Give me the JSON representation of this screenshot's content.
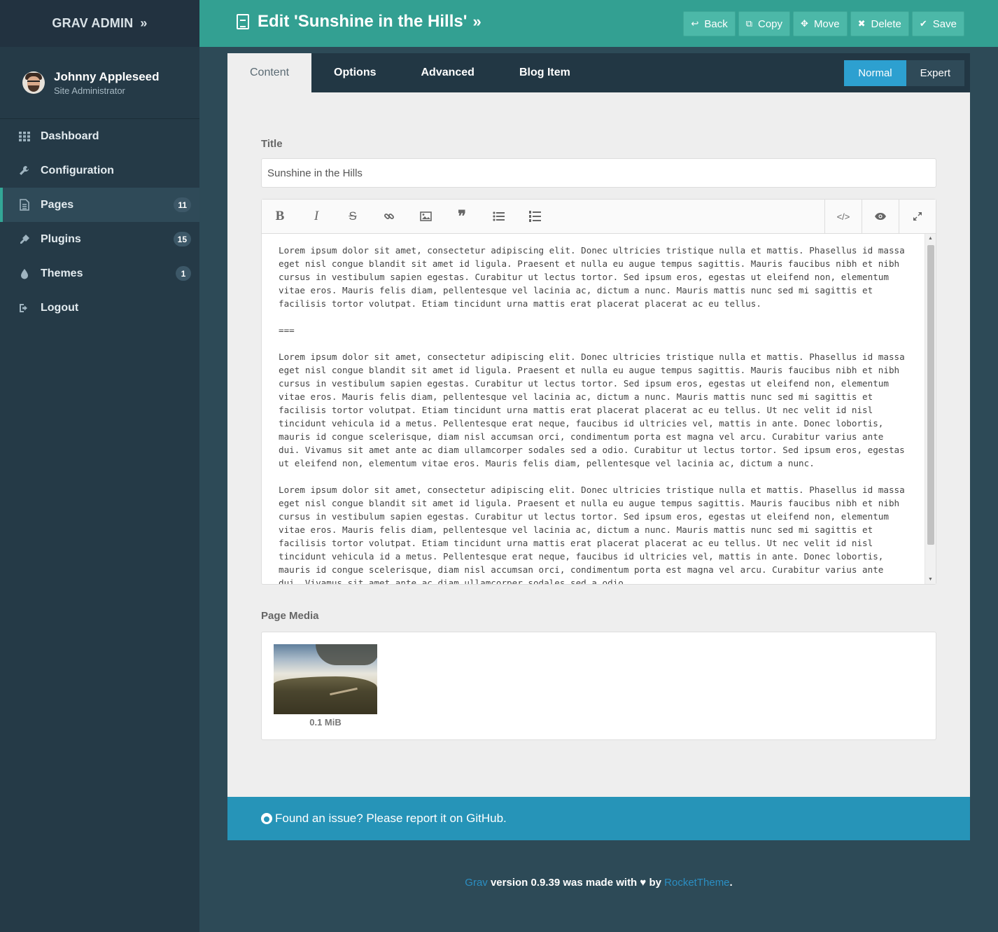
{
  "sidebar": {
    "brand": "GRAV ADMIN",
    "brand_chevron": "»",
    "user": {
      "name": "Johnny Appleseed",
      "role": "Site Administrator"
    },
    "items": [
      {
        "label": "Dashboard",
        "icon": "grid-icon",
        "badge": ""
      },
      {
        "label": "Configuration",
        "icon": "wrench-icon",
        "badge": ""
      },
      {
        "label": "Pages",
        "icon": "file-icon",
        "badge": "11"
      },
      {
        "label": "Plugins",
        "icon": "plug-icon",
        "badge": "15"
      },
      {
        "label": "Themes",
        "icon": "tint-icon",
        "badge": "1"
      },
      {
        "label": "Logout",
        "icon": "sign-out-icon",
        "badge": ""
      }
    ]
  },
  "header": {
    "title": "Edit 'Sunshine in the Hills'",
    "title_chevron": "»",
    "actions": [
      {
        "label": "Back",
        "icon": "reply-icon"
      },
      {
        "label": "Copy",
        "icon": "copy-icon"
      },
      {
        "label": "Move",
        "icon": "arrows-icon"
      },
      {
        "label": "Delete",
        "icon": "close-icon"
      },
      {
        "label": "Save",
        "icon": "check-icon"
      }
    ]
  },
  "tabs": [
    "Content",
    "Options",
    "Advanced",
    "Blog Item"
  ],
  "mode": {
    "normal": "Normal",
    "expert": "Expert"
  },
  "form": {
    "title_label": "Title",
    "title_value": "Sunshine in the Hills",
    "content": "Lorem ipsum dolor sit amet, consectetur adipiscing elit. Donec ultricies tristique nulla et mattis. Phasellus id massa eget nisl congue blandit sit amet id ligula. Praesent et nulla eu augue tempus sagittis. Mauris faucibus nibh et nibh cursus in vestibulum sapien egestas. Curabitur ut lectus tortor. Sed ipsum eros, egestas ut eleifend non, elementum vitae eros. Mauris felis diam, pellentesque vel lacinia ac, dictum a nunc. Mauris mattis nunc sed mi sagittis et facilisis tortor volutpat. Etiam tincidunt urna mattis erat placerat placerat ac eu tellus.\n\n===\n\nLorem ipsum dolor sit amet, consectetur adipiscing elit. Donec ultricies tristique nulla et mattis. Phasellus id massa eget nisl congue blandit sit amet id ligula. Praesent et nulla eu augue tempus sagittis. Mauris faucibus nibh et nibh cursus in vestibulum sapien egestas. Curabitur ut lectus tortor. Sed ipsum eros, egestas ut eleifend non, elementum vitae eros. Mauris felis diam, pellentesque vel lacinia ac, dictum a nunc. Mauris mattis nunc sed mi sagittis et facilisis tortor volutpat. Etiam tincidunt urna mattis erat placerat placerat ac eu tellus. Ut nec velit id nisl tincidunt vehicula id a metus. Pellentesque erat neque, faucibus id ultricies vel, mattis in ante. Donec lobortis, mauris id congue scelerisque, diam nisl accumsan orci, condimentum porta est magna vel arcu. Curabitur varius ante dui. Vivamus sit amet ante ac diam ullamcorper sodales sed a odio. Curabitur ut lectus tortor. Sed ipsum eros, egestas ut eleifend non, elementum vitae eros. Mauris felis diam, pellentesque vel lacinia ac, dictum a nunc.\n\nLorem ipsum dolor sit amet, consectetur adipiscing elit. Donec ultricies tristique nulla et mattis. Phasellus id massa eget nisl congue blandit sit amet id ligula. Praesent et nulla eu augue tempus sagittis. Mauris faucibus nibh et nibh cursus in vestibulum sapien egestas. Curabitur ut lectus tortor. Sed ipsum eros, egestas ut eleifend non, elementum vitae eros. Mauris felis diam, pellentesque vel lacinia ac, dictum a nunc. Mauris mattis nunc sed mi sagittis et facilisis tortor volutpat. Etiam tincidunt urna mattis erat placerat placerat ac eu tellus. Ut nec velit id nisl tincidunt vehicula id a metus. Pellentesque erat neque, faucibus id ultricies vel, mattis in ante. Donec lobortis, mauris id congue scelerisque, diam nisl accumsan orci, condimentum porta est magna vel arcu. Curabitur varius ante dui. Vivamus sit amet ante ac diam ullamcorper sodales sed a odio.",
    "media_label": "Page Media",
    "media_size": "0.1 MiB"
  },
  "footer": {
    "issue_text": "Found an issue? Please report it on GitHub.",
    "credit_grav": "Grav",
    "credit_mid": " version 0.9.39 was made with ",
    "credit_by": " by ",
    "credit_rocket": "RocketTheme",
    "credit_end": "."
  },
  "colors": {
    "sidebar": "#253a47",
    "topbar": "#33a092",
    "accent_blue": "#2da0d0",
    "footer_bar": "#2694b8"
  }
}
